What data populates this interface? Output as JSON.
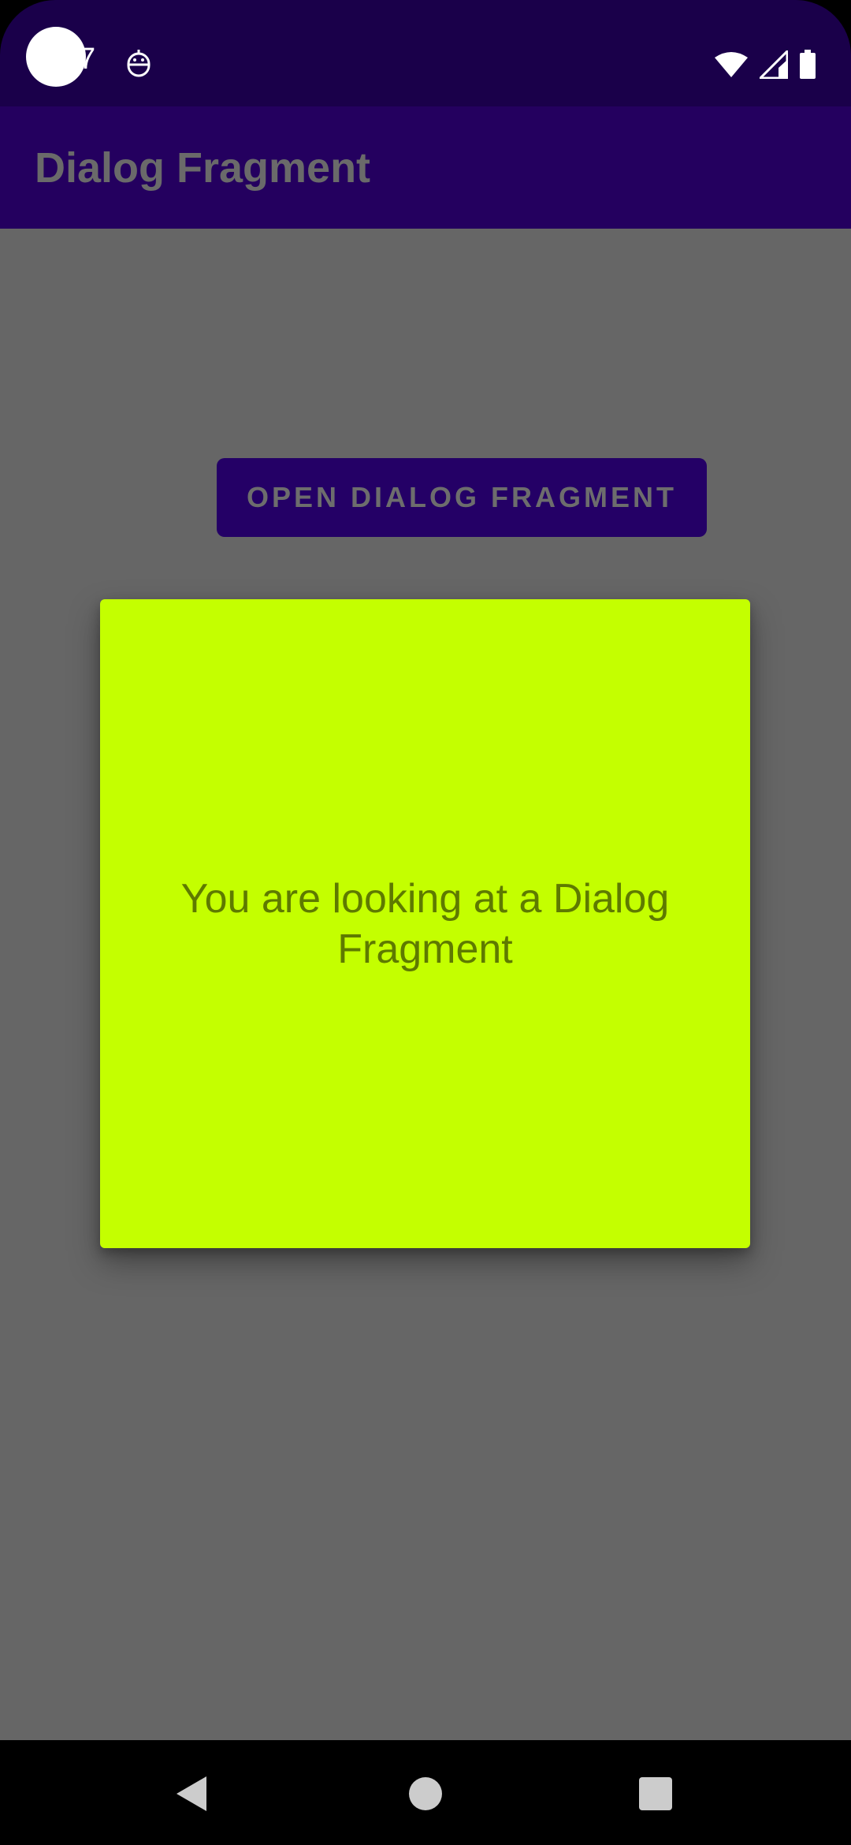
{
  "status_bar": {
    "time": "7",
    "icons": [
      "camera-dot",
      "notification-icon",
      "wifi-icon",
      "signal-icon",
      "battery-icon"
    ]
  },
  "app_bar": {
    "title": "Dialog Fragment"
  },
  "main": {
    "open_button_label": "OPEN DIALOG FRAGMENT"
  },
  "dialog": {
    "message": "You are looking at a Dialog Fragment"
  },
  "nav_bar": {
    "buttons": [
      "back-icon",
      "home-icon",
      "recents-icon"
    ]
  },
  "colors": {
    "status_bar_bg": "#1a004a",
    "app_bar_bg": "#24005f",
    "content_bg": "#666666",
    "button_bg": "#240066",
    "dialog_bg": "#c4ff00",
    "dialog_text": "#5e7a00"
  }
}
